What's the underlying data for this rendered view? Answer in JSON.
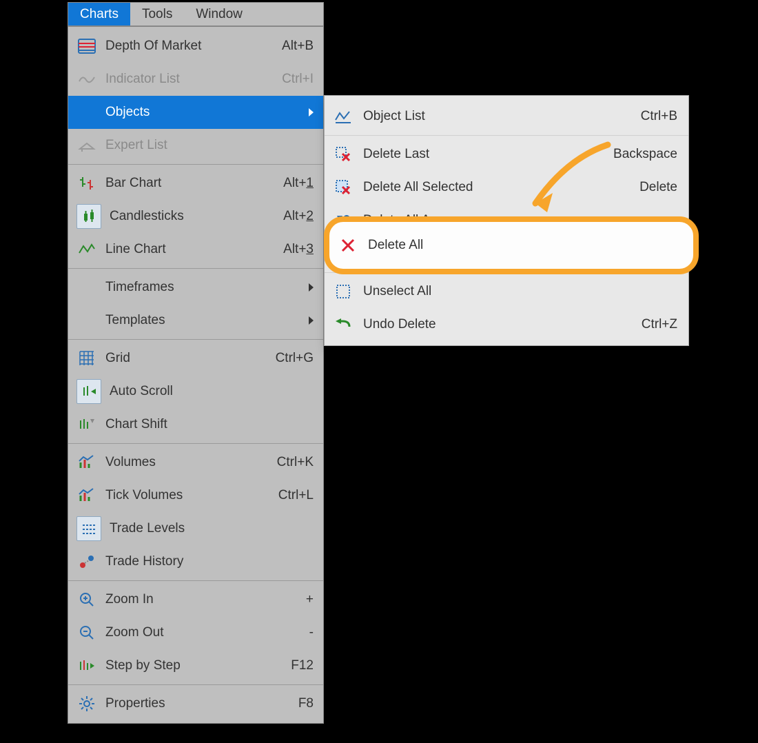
{
  "menubar": {
    "charts": "Charts",
    "tools": "Tools",
    "window": "Window"
  },
  "menu": {
    "depth_of_market": {
      "label": "Depth Of Market",
      "shortcut": "Alt+B"
    },
    "indicator_list": {
      "label": "Indicator List",
      "shortcut": "Ctrl+I"
    },
    "objects": {
      "label": "Objects"
    },
    "expert_list": {
      "label": "Expert List"
    },
    "bar_chart": {
      "label": "Bar Chart",
      "shortcut_prefix": "Alt+",
      "shortcut_key": "1"
    },
    "candlesticks": {
      "label": "Candlesticks",
      "shortcut_prefix": "Alt+",
      "shortcut_key": "2"
    },
    "line_chart": {
      "label": "Line Chart",
      "shortcut_prefix": "Alt+",
      "shortcut_key": "3"
    },
    "timeframes": {
      "label": "Timeframes"
    },
    "templates": {
      "label": "Templates"
    },
    "grid": {
      "label": "Grid",
      "shortcut": "Ctrl+G"
    },
    "auto_scroll": {
      "label": "Auto Scroll"
    },
    "chart_shift": {
      "label": "Chart Shift"
    },
    "volumes": {
      "label": "Volumes",
      "shortcut": "Ctrl+K"
    },
    "tick_volumes": {
      "label": "Tick Volumes",
      "shortcut": "Ctrl+L"
    },
    "trade_levels": {
      "label": "Trade Levels"
    },
    "trade_history": {
      "label": "Trade History"
    },
    "zoom_in": {
      "label": "Zoom In",
      "shortcut": "+"
    },
    "zoom_out": {
      "label": "Zoom Out",
      "shortcut": "-"
    },
    "step_by_step": {
      "label": "Step by Step",
      "shortcut": "F12"
    },
    "properties": {
      "label": "Properties",
      "shortcut": "F8"
    }
  },
  "submenu": {
    "object_list": {
      "label": "Object List",
      "shortcut": "Ctrl+B"
    },
    "delete_last": {
      "label": "Delete Last",
      "shortcut": "Backspace"
    },
    "delete_all_selected": {
      "label": "Delete All Selected",
      "shortcut": "Delete"
    },
    "delete_all_arrows": {
      "label": "Delete All Arrows"
    },
    "delete_all": {
      "label": "Delete All"
    },
    "unselect_all": {
      "label": "Unselect All"
    },
    "undo_delete": {
      "label": "Undo Delete",
      "shortcut": "Ctrl+Z"
    }
  }
}
